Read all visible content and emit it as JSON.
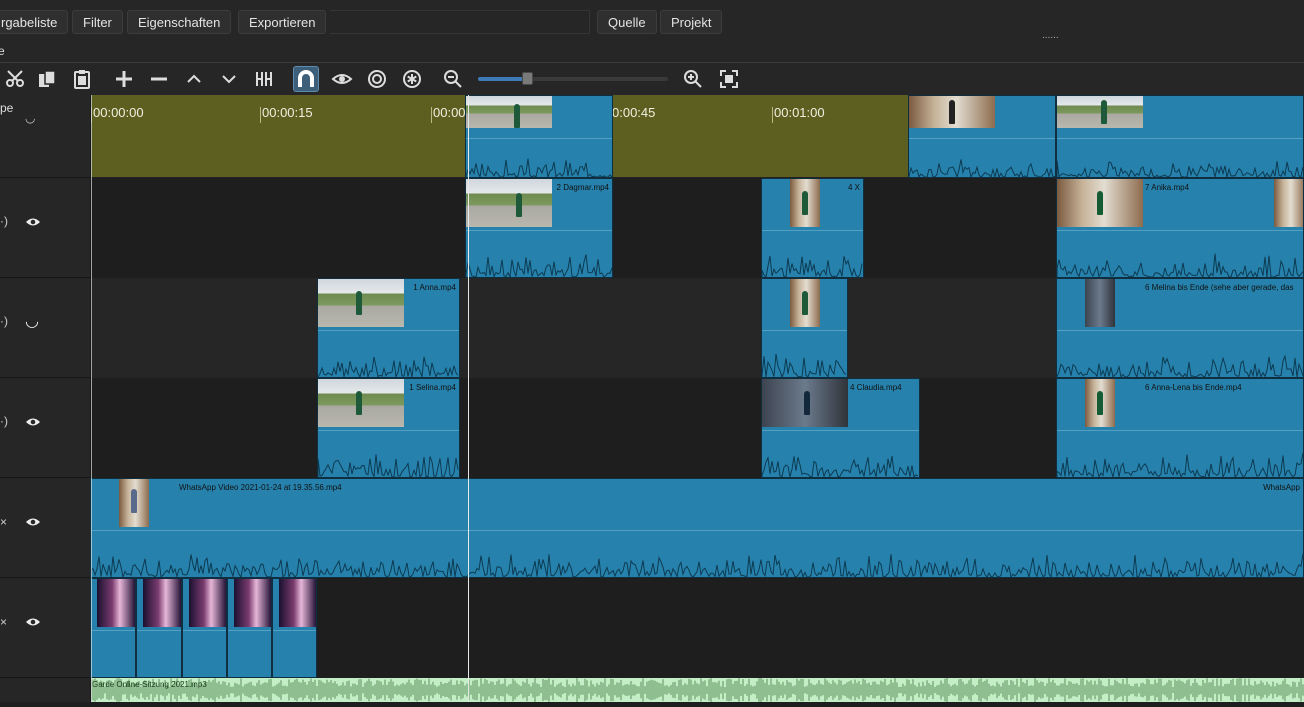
{
  "tabs": {
    "left": [
      "rgabeliste",
      "Filter",
      "Eigenschaften",
      "Exportieren"
    ],
    "right": [
      "Quelle",
      "Projekt"
    ]
  },
  "panel_grip": "......",
  "subtitle": "e",
  "header_label": "pe",
  "track_glyphs": [
    "·)",
    "·)",
    "·)",
    "×",
    "×"
  ],
  "ruler_labels": [
    "00:00:00",
    "00:00:15",
    "00:00",
    "0:00:45",
    "00:01:00"
  ],
  "zoom_value": 0.26,
  "clips": [
    {
      "track": 0,
      "name": ""
    },
    {
      "track": 0,
      "name": ""
    },
    {
      "track": 0,
      "name": ""
    },
    {
      "track": 1,
      "name": "2 Dagmar.mp4"
    },
    {
      "track": 1,
      "name": "4 X"
    },
    {
      "track": 1,
      "name": "7 Anika.mp4"
    },
    {
      "track": 2,
      "name": "1 Anna.mp4"
    },
    {
      "track": 2,
      "name": ""
    },
    {
      "track": 2,
      "name": "6 Melina bis Ende (sehe aber gerade, das"
    },
    {
      "track": 3,
      "name": "1 Selina.mp4"
    },
    {
      "track": 3,
      "name": "4 Claudia.mp4"
    },
    {
      "track": 3,
      "name": "6 Anna-Lena bis Ende.mp4"
    },
    {
      "track": 4,
      "name": "WhatsApp Video 2021-01-24 at 19.35.56.mp4"
    },
    {
      "track": 4,
      "name": "WhatsApp"
    }
  ],
  "audio_clip": "Garde Online-Sitzung 2021.mp3",
  "colors": {
    "ruler": "#5c5f20",
    "clip": "#2682ac",
    "audio": "#c4efc6",
    "snap_active": "#3d5f7a"
  }
}
